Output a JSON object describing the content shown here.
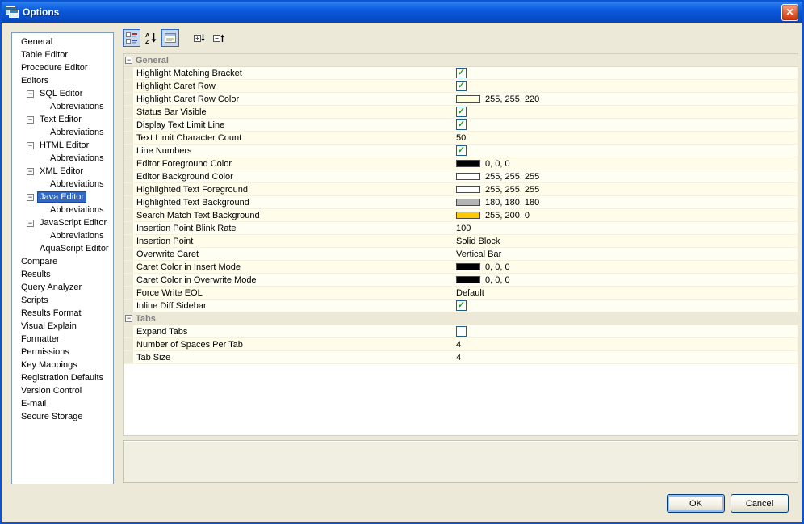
{
  "window": {
    "title": "Options"
  },
  "icons": {
    "close": "✕",
    "collapse": "−",
    "check": "✓"
  },
  "colors": {
    "selection": "#316AC5",
    "titlebar": "#0A59DA",
    "row_bg": "#FFFEF2",
    "category_bg": "#ECE9D8"
  },
  "sidebar": {
    "items": [
      {
        "label": "General",
        "level": 0,
        "selected": false,
        "expander": false
      },
      {
        "label": "Table Editor",
        "level": 0,
        "selected": false,
        "expander": false
      },
      {
        "label": "Procedure Editor",
        "level": 0,
        "selected": false,
        "expander": false
      },
      {
        "label": "Editors",
        "level": 0,
        "selected": false,
        "expander": false
      },
      {
        "label": "SQL Editor",
        "level": 1,
        "selected": false,
        "expander": true
      },
      {
        "label": "Abbreviations",
        "level": 2,
        "selected": false,
        "expander": false
      },
      {
        "label": "Text Editor",
        "level": 1,
        "selected": false,
        "expander": true
      },
      {
        "label": "Abbreviations",
        "level": 2,
        "selected": false,
        "expander": false
      },
      {
        "label": "HTML Editor",
        "level": 1,
        "selected": false,
        "expander": true
      },
      {
        "label": "Abbreviations",
        "level": 2,
        "selected": false,
        "expander": false
      },
      {
        "label": "XML Editor",
        "level": 1,
        "selected": false,
        "expander": true
      },
      {
        "label": "Abbreviations",
        "level": 2,
        "selected": false,
        "expander": false
      },
      {
        "label": "Java Editor",
        "level": 1,
        "selected": true,
        "expander": true
      },
      {
        "label": "Abbreviations",
        "level": 2,
        "selected": false,
        "expander": false
      },
      {
        "label": "JavaScript Editor",
        "level": 1,
        "selected": false,
        "expander": true
      },
      {
        "label": "Abbreviations",
        "level": 2,
        "selected": false,
        "expander": false
      },
      {
        "label": "AquaScript Editor",
        "level": 1,
        "selected": false,
        "expander": false
      },
      {
        "label": "Compare",
        "level": 0,
        "selected": false,
        "expander": false
      },
      {
        "label": "Results",
        "level": 0,
        "selected": false,
        "expander": false
      },
      {
        "label": "Query Analyzer",
        "level": 0,
        "selected": false,
        "expander": false
      },
      {
        "label": "Scripts",
        "level": 0,
        "selected": false,
        "expander": false
      },
      {
        "label": "Results Format",
        "level": 0,
        "selected": false,
        "expander": false
      },
      {
        "label": "Visual Explain",
        "level": 0,
        "selected": false,
        "expander": false
      },
      {
        "label": "Formatter",
        "level": 0,
        "selected": false,
        "expander": false
      },
      {
        "label": "Permissions",
        "level": 0,
        "selected": false,
        "expander": false
      },
      {
        "label": "Key Mappings",
        "level": 0,
        "selected": false,
        "expander": false
      },
      {
        "label": "Registration Defaults",
        "level": 0,
        "selected": false,
        "expander": false
      },
      {
        "label": "Version Control",
        "level": 0,
        "selected": false,
        "expander": false
      },
      {
        "label": "E-mail",
        "level": 0,
        "selected": false,
        "expander": false
      },
      {
        "label": "Secure Storage",
        "level": 0,
        "selected": false,
        "expander": false
      }
    ]
  },
  "toolbar": {
    "buttons": [
      {
        "name": "categorized-view",
        "pressed": true
      },
      {
        "name": "alphabetical-sort",
        "pressed": false
      },
      {
        "name": "show-description",
        "pressed": true
      },
      {
        "name": "expand-all",
        "pressed": false
      },
      {
        "name": "collapse-all",
        "pressed": false
      }
    ]
  },
  "grid": {
    "sections": [
      {
        "label": "General",
        "rows": [
          {
            "name": "Highlight Matching Bracket",
            "type": "checkbox",
            "checked": true
          },
          {
            "name": "Highlight Caret Row",
            "type": "checkbox",
            "checked": true
          },
          {
            "name": "Highlight Caret Row Color",
            "type": "color",
            "swatch": "#FFFFDC",
            "value": "255, 255, 220"
          },
          {
            "name": "Status Bar Visible",
            "type": "checkbox",
            "checked": true
          },
          {
            "name": "Display Text Limit Line",
            "type": "checkbox",
            "checked": true
          },
          {
            "name": "Text Limit Character Count",
            "type": "text",
            "value": "50"
          },
          {
            "name": "Line Numbers",
            "type": "checkbox",
            "checked": true
          },
          {
            "name": "Editor Foreground Color",
            "type": "color",
            "swatch": "#000000",
            "value": "0, 0, 0"
          },
          {
            "name": "Editor Background Color",
            "type": "color",
            "swatch": "#FFFFFF",
            "value": "255, 255, 255"
          },
          {
            "name": "Highlighted Text Foreground",
            "type": "color",
            "swatch": "#FFFFFF",
            "value": "255, 255, 255"
          },
          {
            "name": "Highlighted Text Background",
            "type": "color",
            "swatch": "#B4B4B4",
            "value": "180, 180, 180"
          },
          {
            "name": "Search Match Text Background",
            "type": "color",
            "swatch": "#FFC800",
            "value": "255, 200, 0"
          },
          {
            "name": "Insertion Point Blink Rate",
            "type": "text",
            "value": "100"
          },
          {
            "name": "Insertion Point",
            "type": "text",
            "value": "Solid Block"
          },
          {
            "name": "Overwrite Caret",
            "type": "text",
            "value": "Vertical Bar"
          },
          {
            "name": "Caret Color in Insert Mode",
            "type": "color",
            "swatch": "#000000",
            "value": "0, 0, 0"
          },
          {
            "name": "Caret Color in Overwrite Mode",
            "type": "color",
            "swatch": "#000000",
            "value": "0, 0, 0"
          },
          {
            "name": "Force Write EOL",
            "type": "text",
            "value": "Default"
          },
          {
            "name": "Inline Diff Sidebar",
            "type": "checkbox",
            "checked": true
          }
        ]
      },
      {
        "label": "Tabs",
        "rows": [
          {
            "name": "Expand Tabs",
            "type": "checkbox",
            "checked": false
          },
          {
            "name": "Number of Spaces Per Tab",
            "type": "text",
            "value": "4"
          },
          {
            "name": "Tab Size",
            "type": "text",
            "value": "4"
          }
        ]
      }
    ]
  },
  "buttons": {
    "ok_label": "OK",
    "cancel_label": "Cancel"
  }
}
